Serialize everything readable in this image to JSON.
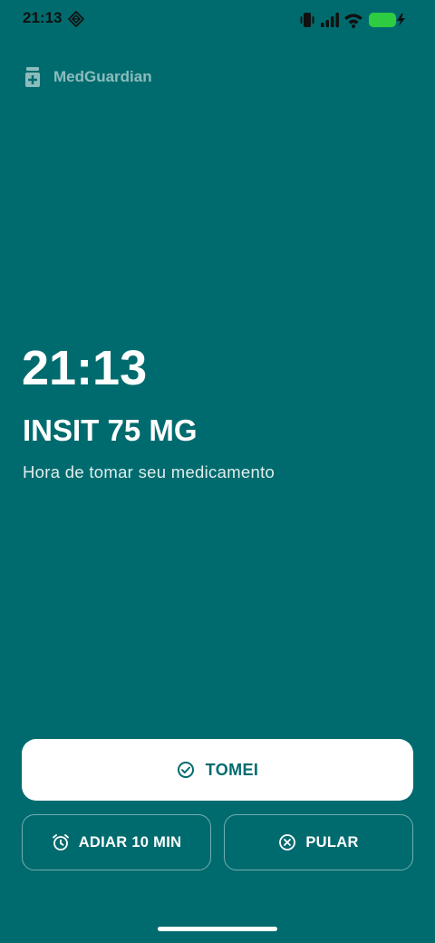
{
  "status_bar": {
    "time": "21:13",
    "icons": [
      "app-notification-icon",
      "vibrate-icon",
      "signal-icon",
      "wifi-icon",
      "battery-charging-icon"
    ],
    "battery_color": "#2ecc40"
  },
  "app": {
    "name": "MedGuardian",
    "icon": "medicine-bottle-icon"
  },
  "alarm": {
    "time": "21:13",
    "medication": "INSIT 75 MG",
    "message": "Hora de tomar seu medicamento"
  },
  "actions": {
    "taken": {
      "label": "TOMEI",
      "icon": "check-circle-icon"
    },
    "snooze": {
      "label": "ADIAR 10 MIN",
      "icon": "alarm-clock-icon"
    },
    "skip": {
      "label": "PULAR",
      "icon": "x-circle-icon"
    }
  },
  "colors": {
    "background": "#006b6e",
    "primary_button": "#ffffff",
    "primary_button_text": "#006b6e",
    "text": "#ffffff"
  }
}
